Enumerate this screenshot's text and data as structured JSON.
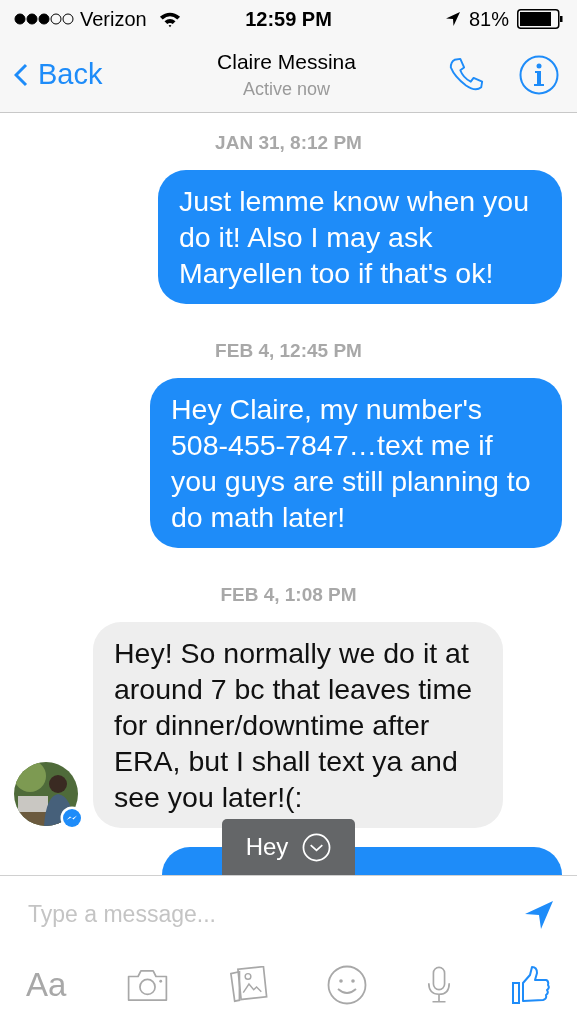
{
  "status_bar": {
    "carrier": "Verizon",
    "time": "12:59 PM",
    "battery": "81%"
  },
  "header": {
    "back": "Back",
    "name": "Claire Messina",
    "status": "Active now"
  },
  "messages": [
    {
      "kind": "timestamp",
      "text": "JAN 31, 8:12 PM"
    },
    {
      "kind": "message",
      "outgoing": true,
      "text": "Just lemme know when you do it! Also I may ask Maryellen too if that's ok!"
    },
    {
      "kind": "timestamp",
      "text": "FEB 4, 12:45 PM"
    },
    {
      "kind": "message",
      "outgoing": true,
      "text": "Hey Claire, my number's 508-455-7847…text me if you guys are still planning to do math later!"
    },
    {
      "kind": "timestamp",
      "text": "FEB 4, 1:08 PM"
    },
    {
      "kind": "message",
      "outgoing": false,
      "text": "Hey! So normally we do it at around 7 bc that leaves time for dinner/downtime after ERA, but I shall text ya and see you later!(:"
    },
    {
      "kind": "cut_bubble",
      "outgoing": true
    }
  ],
  "suggestion": {
    "label": "Hey"
  },
  "composer": {
    "placeholder": "Type a message..."
  },
  "toolbar": {
    "text_button": "Aa"
  }
}
